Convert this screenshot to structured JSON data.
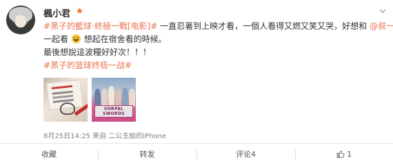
{
  "user": {
    "name": "楓小君",
    "badge_icon": "vip-star-icon"
  },
  "post": {
    "line1": {
      "topic": "#黑子的籃球·終極一戰[电影]#",
      "text": "一直忍著到上映才看，一個人看得又燃又笑又哭，好想和",
      "mention": "@叔一筋"
    },
    "line2": {
      "text_before_emoji": "一起看",
      "emoji": "smiley-emoji",
      "text_after_emoji": "想起在宿舍看的時候。"
    },
    "line3": "最後想說這波糧好好次！！！",
    "line4_topic": "#黑子的篮球终极一战#",
    "images": [
      {
        "name": "photo-notebook-drawing"
      },
      {
        "name": "photo-anime-team-banner",
        "banner_text_1": "VORPAL",
        "banner_text_2": "SWORDS"
      }
    ],
    "meta": "8月25日14:25 来自 二公主給的iPhone"
  },
  "actions": {
    "favorite": "收藏",
    "repost": "转发",
    "comment": "评论4",
    "like_icon": "thumbs-up-icon",
    "like_count": "1"
  },
  "colors": {
    "link": "#eb7350",
    "text": "#333333",
    "meta": "#808080"
  }
}
